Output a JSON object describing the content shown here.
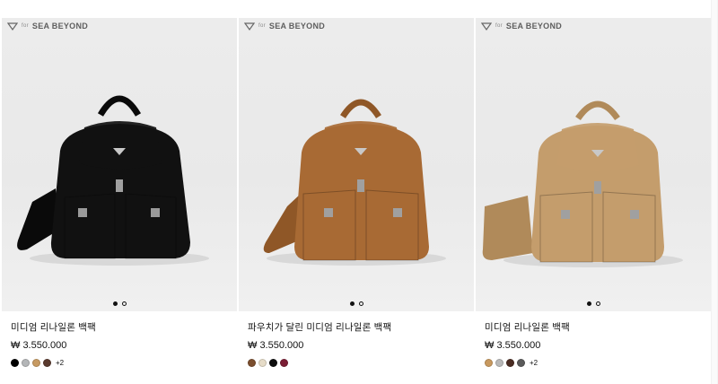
{
  "brand": {
    "for_label": "for",
    "name": "SEA BEYOND"
  },
  "products": [
    {
      "title": "미디엄 리나일론 백팩",
      "price": "₩ 3.550.000",
      "main_color": "#111111",
      "strap_color": "#0a0a0a",
      "swatches": [
        "#000000",
        "#b4b6b8",
        "#c79a62",
        "#5a3a2e"
      ],
      "more": "+2",
      "carousel": {
        "current": 1,
        "total": 2
      }
    },
    {
      "title": "파우치가 달린 미디엄 리나일론 백팩",
      "price": "₩ 3.550.000",
      "main_color": "#a86a34",
      "strap_color": "#8f5727",
      "swatches": [
        "#7b4e2e",
        "#e6dcc8",
        "#0d0d0d",
        "#7a1d34"
      ],
      "more": "",
      "carousel": {
        "current": 1,
        "total": 2
      }
    },
    {
      "title": "미디엄 리나일론 백팩",
      "price": "₩ 3.550.000",
      "main_color": "#c49d6c",
      "strap_color": "#b08a5a",
      "swatches": [
        "#c8995f",
        "#b9b9b9",
        "#4a2c22",
        "#5a5a5a"
      ],
      "more": "+2",
      "carousel": {
        "current": 1,
        "total": 2
      }
    }
  ]
}
